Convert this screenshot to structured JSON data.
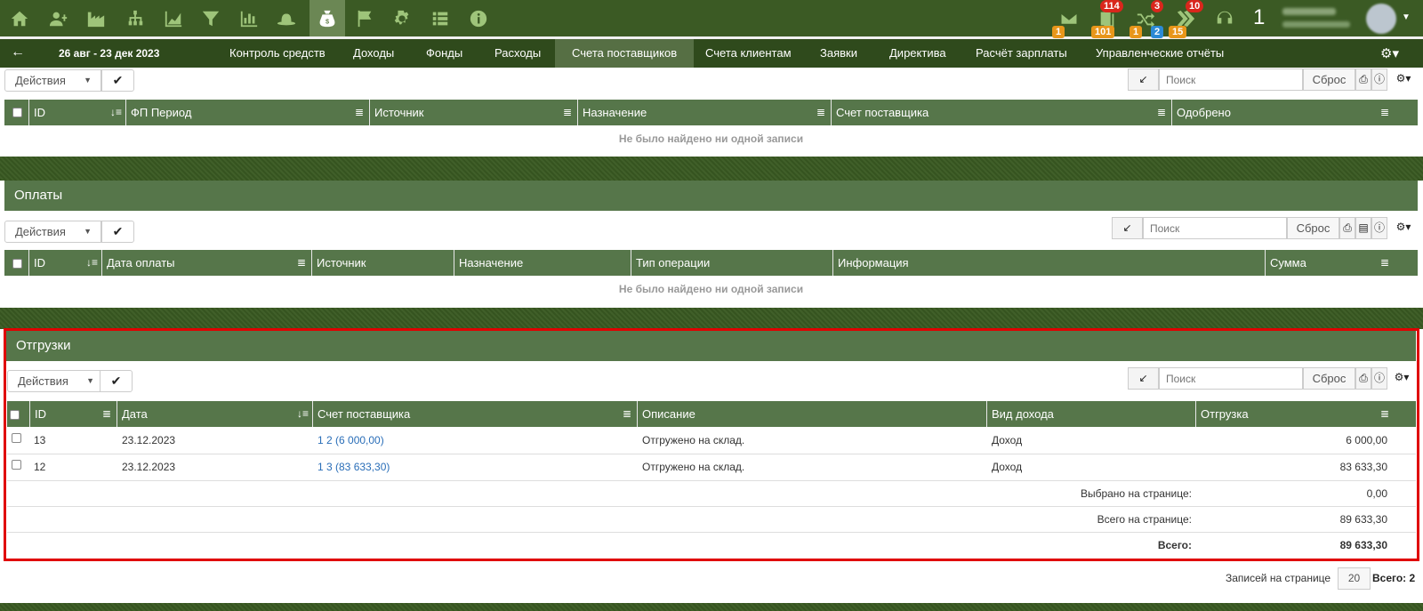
{
  "topbar": {
    "icons": [
      "home-icon",
      "users-icon",
      "factory-icon",
      "org-chart-icon",
      "area-chart-icon",
      "filter-icon",
      "bar-chart-icon",
      "hat-icon",
      "money-bag-icon",
      "flag-icon",
      "gear-icon",
      "list-icon",
      "info-icon"
    ],
    "badges": {
      "mail_count": "1",
      "docs_top": "114",
      "docs_bottom": "101",
      "shuffle_top": "3",
      "shuffle_left": "1",
      "shuffle_right": "2",
      "forward_top": "10",
      "forward_bottom": "15"
    },
    "counter": "1"
  },
  "nav": {
    "back_icon": "arrow-left-icon",
    "date_range": "26 авг - 23 дек 2023",
    "tabs": [
      "Контроль средств",
      "Доходы",
      "Фонды",
      "Расходы",
      "Счета поставщиков",
      "Счета клиентам",
      "Заявки",
      "Директива",
      "Расчёт зарплаты",
      "Управленческие отчёты"
    ],
    "active_tab": "Счета поставщиков"
  },
  "common": {
    "actions_label": "Действия",
    "search_placeholder": "Поиск",
    "reset_label": "Сброс",
    "no_records": "Не было найдено ни одной записи"
  },
  "approvals_table": {
    "columns": [
      "ID",
      "ФП Период",
      "Источник",
      "Назначение",
      "Счет поставщика",
      "Одобрено"
    ]
  },
  "payments": {
    "title": "Оплаты",
    "columns": [
      "ID",
      "Дата оплаты",
      "Источник",
      "Назначение",
      "Тип операции",
      "Информация",
      "Сумма"
    ]
  },
  "shipments": {
    "title": "Отгрузки",
    "columns": [
      "ID",
      "Дата",
      "Счет поставщика",
      "Описание",
      "Вид дохода",
      "Отгрузка"
    ],
    "rows": [
      {
        "id": "13",
        "date": "23.12.2023",
        "invoice": "1 2 (6 000,00)",
        "description": "Отгружено на склад.",
        "income_type": "Доход",
        "amount": "6 000,00"
      },
      {
        "id": "12",
        "date": "23.12.2023",
        "invoice": "1 3 (83 633,30)",
        "description": "Отгружено на склад.",
        "income_type": "Доход",
        "amount": "83 633,30"
      }
    ],
    "summary": {
      "selected_label": "Выбрано на странице:",
      "selected_value": "0,00",
      "page_total_label": "Всего на странице:",
      "page_total_value": "89 633,30",
      "total_label": "Всего:",
      "total_value": "89 633,30"
    },
    "pagination": {
      "per_page_label": "Записей на странице",
      "per_page_value": "20",
      "total_label": "Всего: 2"
    }
  },
  "colors": {
    "topbar": "#3b5a24",
    "navbar": "#2f4a1c",
    "table_header": "#56764a",
    "highlight_box": "#e00000",
    "link": "#2a6eb8"
  }
}
